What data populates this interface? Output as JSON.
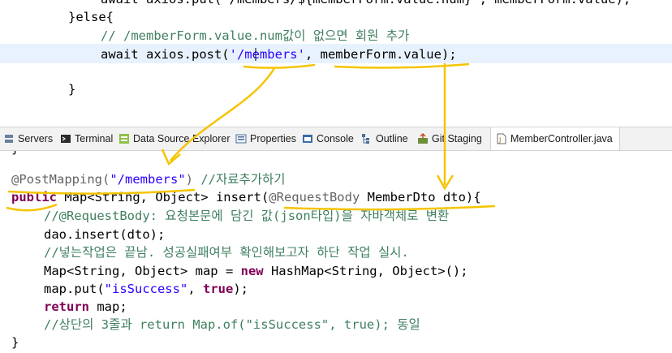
{
  "editor_top": {
    "line1": "await axios.put(`/members/${memberForm.value.num}`, memberForm.value);",
    "line2_kw": "}else{",
    "line3_comment": "// /memberForm.value.num값이 없으면 회원 추가",
    "line4_prefix": "await axios.post(",
    "line4_string": "'/members'",
    "line4_suffix": ", memberForm.value);",
    "line6": "}"
  },
  "views_tabs": [
    {
      "label": "Servers",
      "icon": "servers-icon"
    },
    {
      "label": "Terminal",
      "icon": "terminal-icon"
    },
    {
      "label": "Data Source Explorer",
      "icon": "data-source-explorer-icon"
    },
    {
      "label": "Properties",
      "icon": "properties-icon"
    },
    {
      "label": "Console",
      "icon": "console-icon"
    },
    {
      "label": "Outline",
      "icon": "outline-icon"
    },
    {
      "label": "Git Staging",
      "icon": "git-staging-icon"
    },
    {
      "label": "MemberController.java",
      "icon": "java-file-icon"
    }
  ],
  "editor_bottom": {
    "line0": "}",
    "ann1": "@PostMapping(",
    "ann1_string": "\"/members\"",
    "ann1_close": ")",
    "ann1_comment": "//자료추가하기",
    "sig_kw": "public",
    "sig_rest1": " Map<String, Object> insert(",
    "sig_ann": "@RequestBody",
    "sig_rest2": " MemberDto dto){",
    "c1": "//@RequestBody: 요청본문에 담긴 값(json타입)을 자바객체로 변환",
    "l2": "dao.insert(dto);",
    "c3": "//넣는작업은 끝남. 성공실패여부 확인해보고자 하단 작업 실시.",
    "l4a": "Map<String, Object> map = ",
    "l4_kw": "new",
    "l4b": " HashMap<String, Object>();",
    "l5a": "map.put(",
    "l5_str": "\"isSuccess\"",
    "l5_mid": ", ",
    "l5_kw": "true",
    "l5_end": ");",
    "l6_kw": "return",
    "l6_rest": " map;",
    "c7": "//상단의 3줄과 return Map.of(\"isSuccess\", true); 동일",
    "l8": "}"
  },
  "colors": {
    "keyword": "#7f0055",
    "string": "#2a00ff",
    "comment": "#3f7f5f",
    "annotation": "#646464",
    "highlight": "#e8f2fe",
    "marker": "#f5c400"
  }
}
